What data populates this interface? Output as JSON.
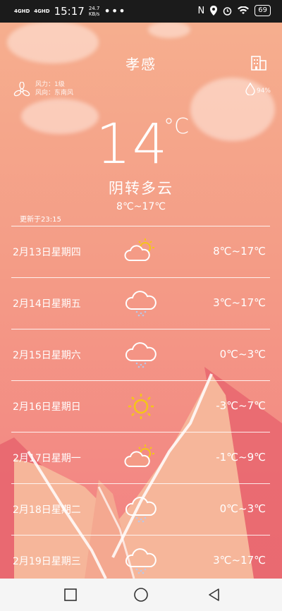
{
  "status_bar": {
    "net1": "4GHD",
    "net2": "4GHD",
    "time": "15:17",
    "speed_value": "24.7",
    "speed_unit": "KB/s",
    "battery": "69"
  },
  "header": {
    "city": "孝感"
  },
  "wind": {
    "force": "风力：1级",
    "direction": "风向：东南风"
  },
  "humidity": "94%",
  "current": {
    "temp": "14",
    "unit": "°C",
    "condition": "阴转多云",
    "range": "8℃~17℃",
    "updated": "更新于23:15"
  },
  "forecast": [
    {
      "date": "2月13日星期四",
      "icon": "partly-cloudy-icon",
      "range": "8℃~17℃"
    },
    {
      "date": "2月14日星期五",
      "icon": "rain-cloud-icon",
      "range": "3℃~17℃"
    },
    {
      "date": "2月15日星期六",
      "icon": "rain-cloud-icon",
      "range": "0℃~3℃"
    },
    {
      "date": "2月16日星期日",
      "icon": "sun-icon",
      "range": "-3℃~7℃"
    },
    {
      "date": "2月17日星期一",
      "icon": "partly-cloudy-icon",
      "range": "-1℃~9℃"
    },
    {
      "date": "2月18日星期二",
      "icon": "rain-cloud-icon",
      "range": "0℃~3℃"
    },
    {
      "date": "2月19日星期三",
      "icon": "rain-cloud-icon",
      "range": "3℃~17℃"
    }
  ],
  "colors": {
    "bg_top": "#f6b08f",
    "bg_bottom": "#f27d82",
    "sun": "#f5c518",
    "mountain_light": "#f6b69a",
    "mountain_dark": "#e8666f"
  }
}
